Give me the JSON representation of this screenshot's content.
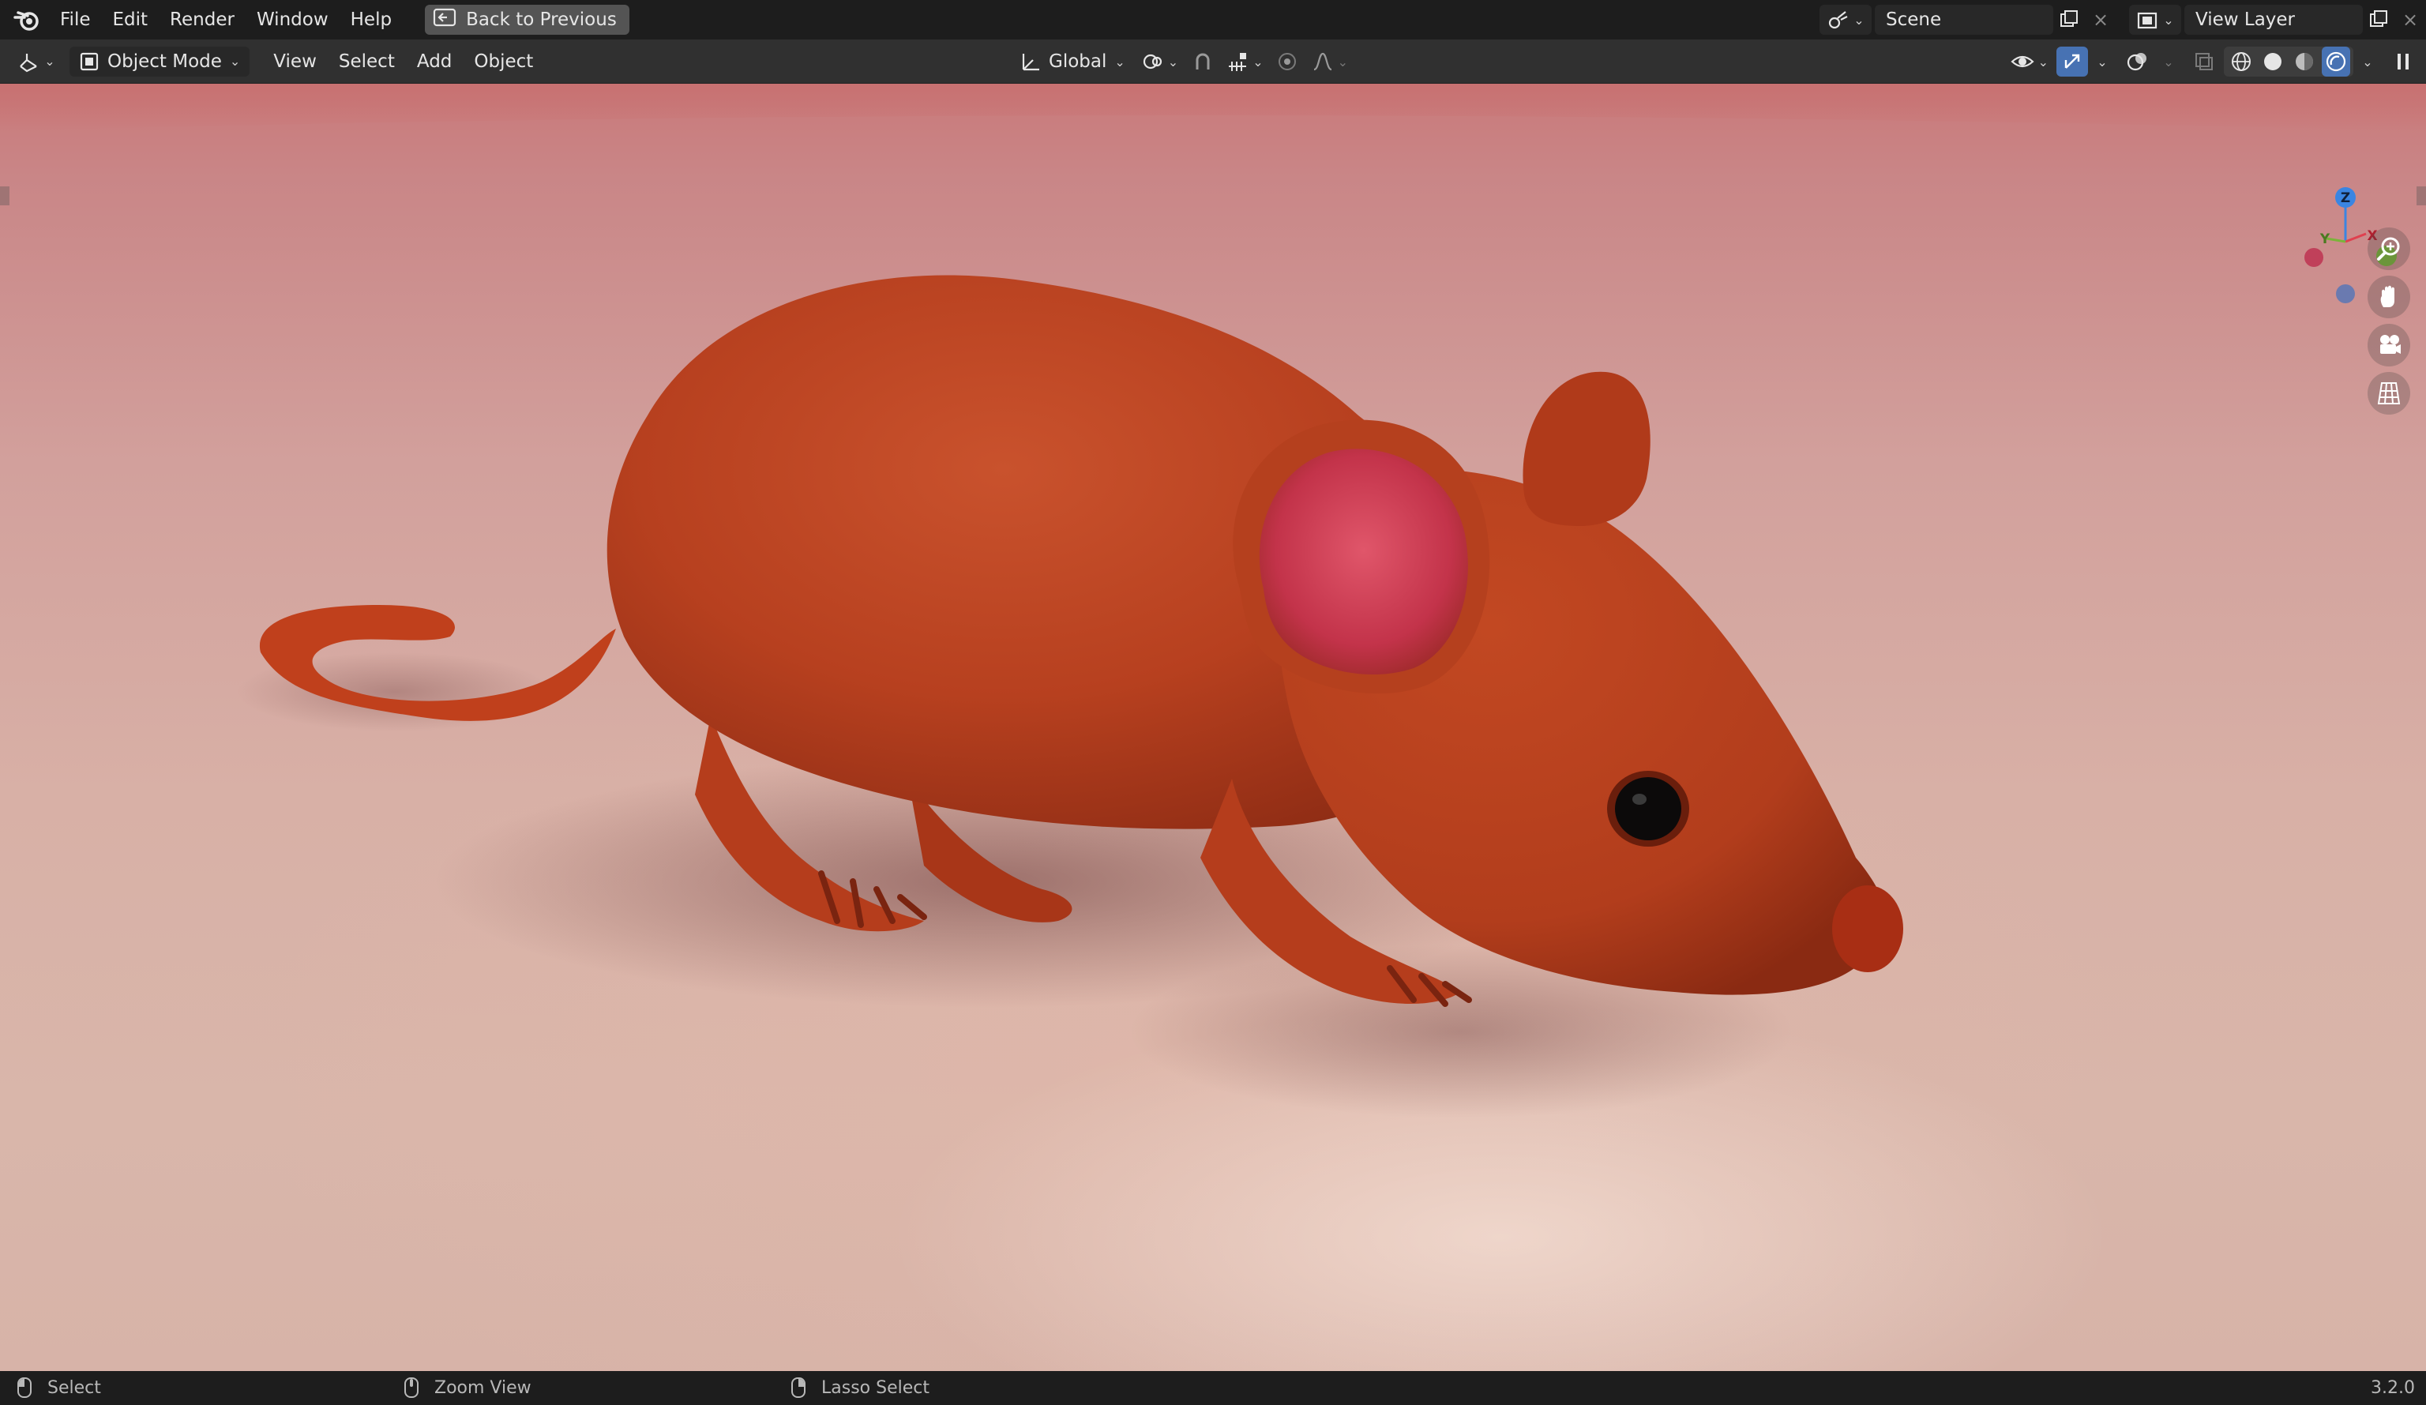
{
  "topbar": {
    "menus": [
      "File",
      "Edit",
      "Render",
      "Window",
      "Help"
    ],
    "back_button": "Back to Previous",
    "scene_name": "Scene",
    "view_layer_name": "View Layer"
  },
  "header": {
    "mode": "Object Mode",
    "menus": [
      "View",
      "Select",
      "Add",
      "Object"
    ],
    "transform_orientation": "Global"
  },
  "viewport": {
    "gizmo_axes": {
      "x": "X",
      "y": "Y",
      "z": "Z"
    },
    "colors": {
      "x_axis": "#e0404f",
      "y_axis": "#7bb33a",
      "z_axis": "#3a85e2",
      "mouse_fur": "#c2401e",
      "ear_inner": "#c73346",
      "floor": "#d8b2a8"
    }
  },
  "statusbar": {
    "left_mouse": "Select",
    "middle_mouse": "Zoom View",
    "right_mouse": "Lasso Select",
    "version": "3.2.0"
  },
  "icons": [
    "blender-logo-icon",
    "back-icon",
    "editor-type-icon",
    "object-mode-icon",
    "orientation-icon",
    "pivot-icon",
    "snap-icon",
    "proportional-icon",
    "visibility-icon",
    "gizmo-icon",
    "overlay-icon",
    "xray-icon",
    "shading-wire-icon",
    "shading-solid-icon",
    "shading-material-icon",
    "shading-rendered-icon",
    "zoom-icon",
    "pan-hand-icon",
    "camera-icon",
    "ortho-grid-icon"
  ]
}
